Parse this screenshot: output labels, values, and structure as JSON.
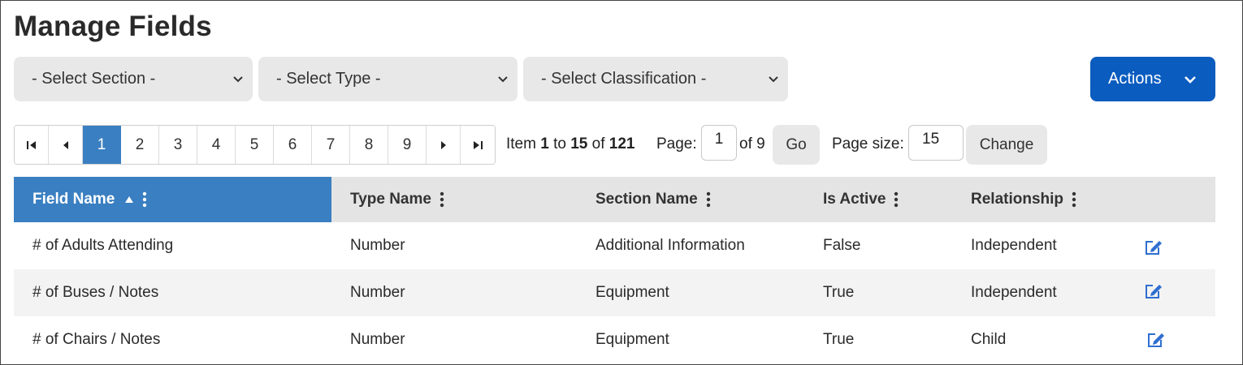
{
  "page": {
    "title": "Manage Fields"
  },
  "filters": {
    "section": "- Select Section -",
    "type": "- Select Type -",
    "classification": "- Select Classification -"
  },
  "actions": {
    "label": "Actions"
  },
  "pager": {
    "pages": [
      "1",
      "2",
      "3",
      "4",
      "5",
      "6",
      "7",
      "8",
      "9"
    ],
    "active_page": "1",
    "item_label": "Item",
    "item_from": "1",
    "to_label": "to",
    "item_to": "15",
    "of_label": "of",
    "item_total": "121",
    "page_label": "Page:",
    "page_value": "1",
    "of_pages": "of 9",
    "go_label": "Go",
    "page_size_label": "Page size:",
    "page_size_value": "15",
    "change_label": "Change"
  },
  "table": {
    "columns": [
      "Field Name",
      "Type Name",
      "Section Name",
      "Is Active",
      "Relationship"
    ],
    "rows": [
      {
        "field": "# of Adults Attending",
        "type": "Number",
        "section": "Additional Information",
        "active": "False",
        "relationship": "Independent"
      },
      {
        "field": "# of Buses / Notes",
        "type": "Number",
        "section": "Equipment",
        "active": "True",
        "relationship": "Independent"
      },
      {
        "field": "# of Chairs / Notes",
        "type": "Number",
        "section": "Equipment",
        "active": "True",
        "relationship": "Child"
      }
    ]
  },
  "icons": {
    "select_chevron": "chevron-down-icon",
    "first": "first-page-icon",
    "prev": "prev-page-icon",
    "next": "next-page-icon",
    "last": "last-page-icon",
    "sort": "sort-ascending-icon",
    "column_menu": "kebab-menu-icon",
    "edit": "edit-icon"
  },
  "colors": {
    "accent": "#0a5cbf",
    "header_sorted": "#3a7fc1",
    "edit_icon": "#2f6fd0"
  }
}
